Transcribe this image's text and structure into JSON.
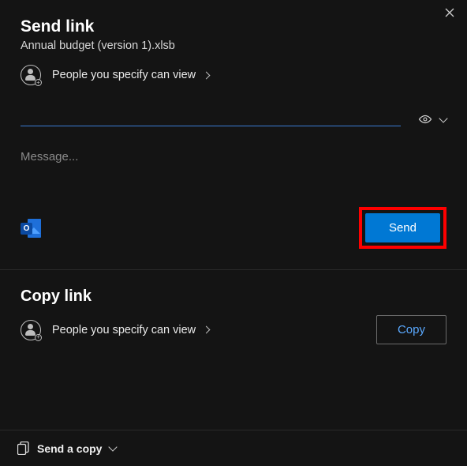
{
  "close_label": "Close",
  "send": {
    "title": "Send link",
    "filename": "Annual budget (version 1).xlsb",
    "permission_text": "People you specify can view",
    "recipient_placeholder": "",
    "message_placeholder": "Message...",
    "send_button": "Send"
  },
  "copy": {
    "title": "Copy link",
    "permission_text": "People you specify can view",
    "copy_button": "Copy"
  },
  "footer": {
    "send_copy": "Send a copy"
  },
  "colors": {
    "accent": "#0078d4",
    "highlight": "#ff0000"
  }
}
